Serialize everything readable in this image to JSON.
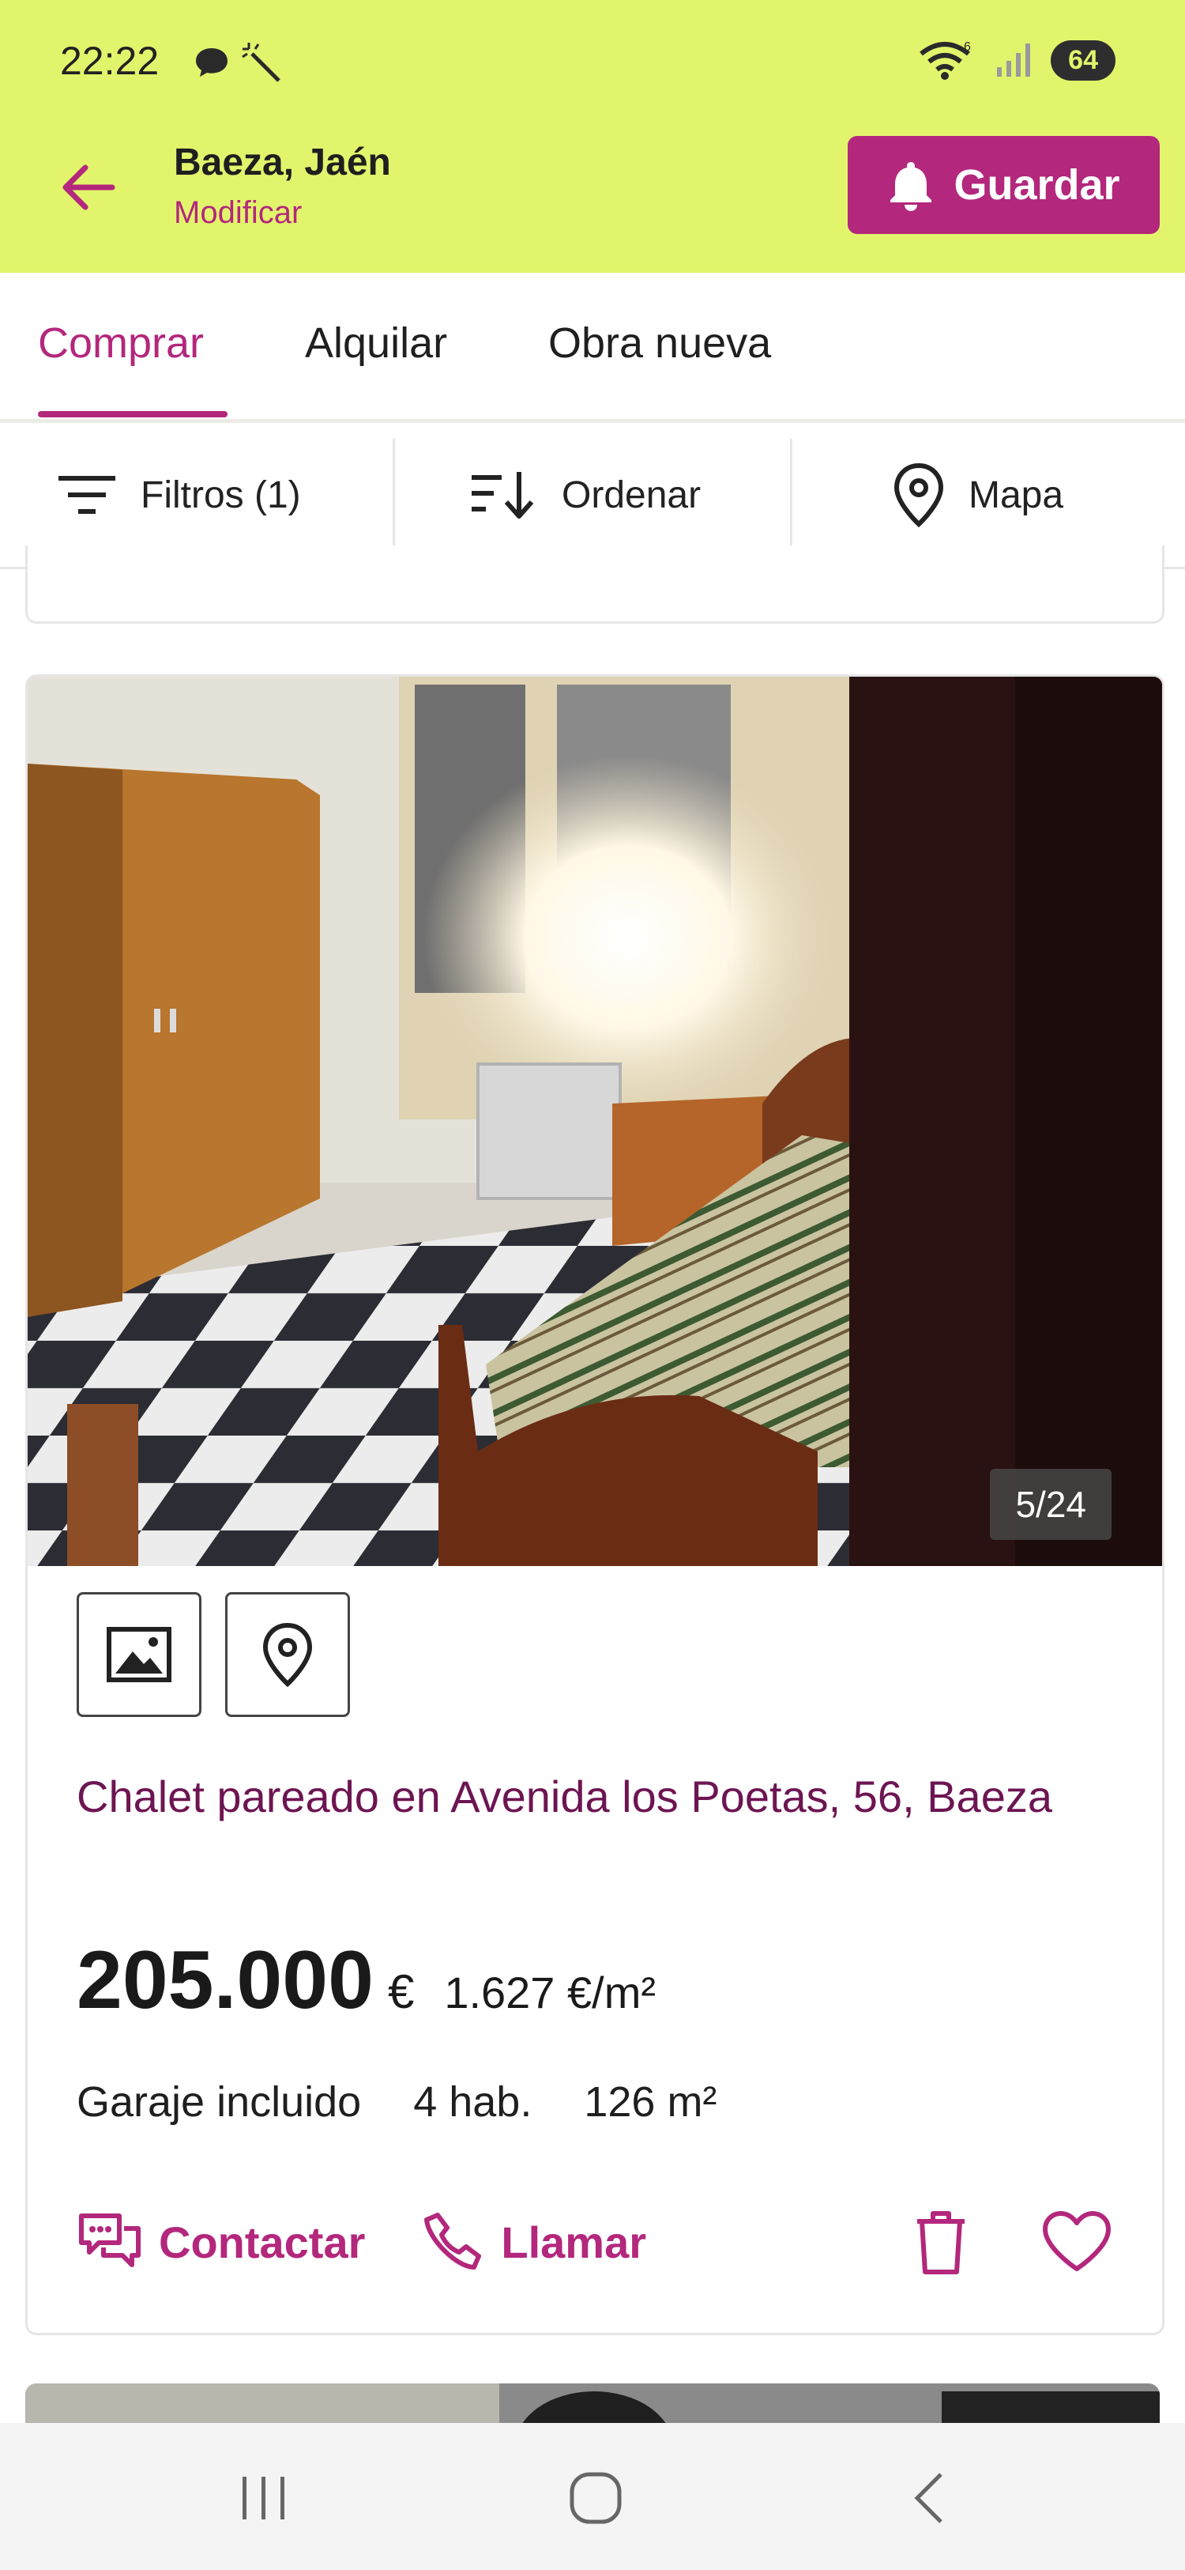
{
  "status_bar": {
    "time": "22:22",
    "battery": "64"
  },
  "header": {
    "location_title": "Baeza, Jaén",
    "modify_label": "Modificar",
    "save_label": "Guardar"
  },
  "tabs": [
    {
      "label": "Comprar",
      "active": true
    },
    {
      "label": "Alquilar",
      "active": false
    },
    {
      "label": "Obra nueva",
      "active": false
    }
  ],
  "filters": {
    "filter_label": "Filtros (1)",
    "sort_label": "Ordenar",
    "map_label": "Mapa"
  },
  "listing": {
    "photo_counter": "5/24",
    "title": "Chalet pareado en Avenida los Poetas, 56, Baeza",
    "price": "205.000",
    "currency": "€",
    "price_per_m2": "1.627 €/m²",
    "features": [
      "Garaje incluido",
      "4 hab.",
      "126 m²"
    ],
    "contact_label": "Contactar",
    "call_label": "Llamar"
  },
  "colors": {
    "accent": "#b3277c",
    "header_bg": "#e2f46c",
    "title_color": "#6d1552"
  },
  "icons": [
    "back-arrow-icon",
    "bell-icon",
    "filter-icon",
    "sort-icon",
    "map-pin-icon",
    "gallery-icon",
    "location-icon",
    "chat-icon",
    "phone-icon",
    "trash-icon",
    "heart-icon"
  ]
}
